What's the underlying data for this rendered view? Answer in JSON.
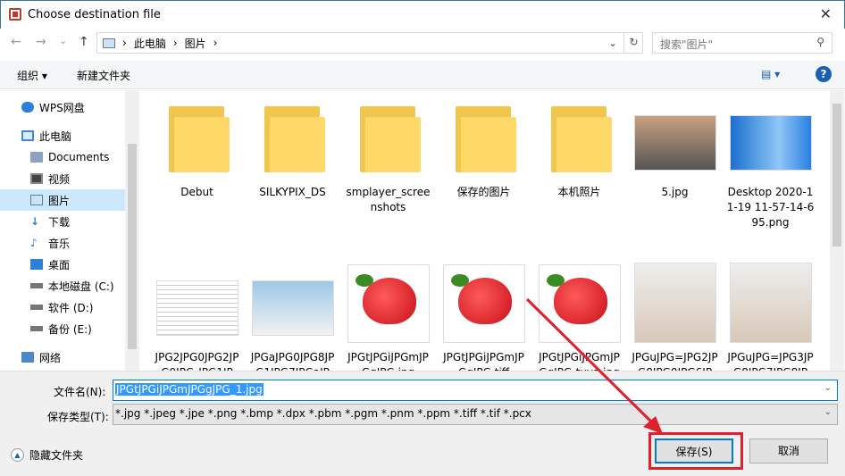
{
  "window": {
    "title": "Choose destination file",
    "close": "✕"
  },
  "address": {
    "back": "←",
    "forward": "→",
    "down": "⌄",
    "up": "↑",
    "path": [
      "此电脑",
      "图片"
    ],
    "sep": "›",
    "path_dropdown": "⌄",
    "refresh": "↻",
    "search_placeholder": "搜索\"图片\"",
    "search_icon": "⚲"
  },
  "toolbar": {
    "organize": "组织 ▾",
    "new_folder": "新建文件夹",
    "view": "▤ ▾",
    "help": "?"
  },
  "sidebar": {
    "items": [
      {
        "label": "WPS网盘",
        "icon": "cloud-icon"
      },
      {
        "label": "此电脑",
        "icon": "computer-icon"
      },
      {
        "label": "Documents",
        "icon": "documents-icon"
      },
      {
        "label": "视频",
        "icon": "video-icon"
      },
      {
        "label": "图片",
        "icon": "pictures-icon",
        "selected": true
      },
      {
        "label": "下载",
        "icon": "download-icon"
      },
      {
        "label": "音乐",
        "icon": "music-icon"
      },
      {
        "label": "桌面",
        "icon": "desktop-icon"
      },
      {
        "label": "本地磁盘 (C:)",
        "icon": "drive-icon"
      },
      {
        "label": "软件 (D:)",
        "icon": "drive-icon"
      },
      {
        "label": "备份 (E:)",
        "icon": "drive-icon"
      },
      {
        "label": "网络",
        "icon": "network-icon"
      }
    ]
  },
  "files": [
    {
      "name": "Debut",
      "type": "folder"
    },
    {
      "name": "SILKYPIX_DS",
      "type": "folder"
    },
    {
      "name": "smplayer_screenshots",
      "type": "folder"
    },
    {
      "name": "保存的图片",
      "type": "folder"
    },
    {
      "name": "本机照片",
      "type": "folder"
    },
    {
      "name": "5.jpg",
      "type": "image"
    },
    {
      "name": "Desktop 2020-11-19 11-57-14-695.png",
      "type": "image"
    },
    {
      "name": "JPG2JPG0JPG2JPG0JPG-JPG1JP",
      "type": "image"
    },
    {
      "name": "JPGaJPG0JPG8JPG1JPG7JPGaJP",
      "type": "image"
    },
    {
      "name": "JPGtJPGiJPGmJPGgJPG.jpg",
      "type": "strawberry"
    },
    {
      "name": "JPGtJPGiJPGmJPGgJPG.tiff",
      "type": "strawberry"
    },
    {
      "name": "JPGtJPGiJPGmJPGgJPG-tuya.jpg",
      "type": "strawberry"
    },
    {
      "name": "JPGuJPG=JPG2JPG8JPG0JPG6JP",
      "type": "image"
    },
    {
      "name": "JPGuJPG=JPG3JPG8JPG7JPG8JP",
      "type": "image"
    }
  ],
  "bottom": {
    "filename_label": "文件名(N):",
    "filename_value": "JPGtJPGiJPGmJPGgJPG_1.jpg",
    "filetype_label": "保存类型(T):",
    "filetype_value": "*.jpg *.jpeg *.jpe *.png *.bmp *.dpx *.pbm *.pgm *.pnm *.ppm *.tiff *.tif *.pcx",
    "hide_folders": "隐藏文件夹",
    "save": "保存(S)",
    "cancel": "取消",
    "dropdown": "⌄"
  }
}
